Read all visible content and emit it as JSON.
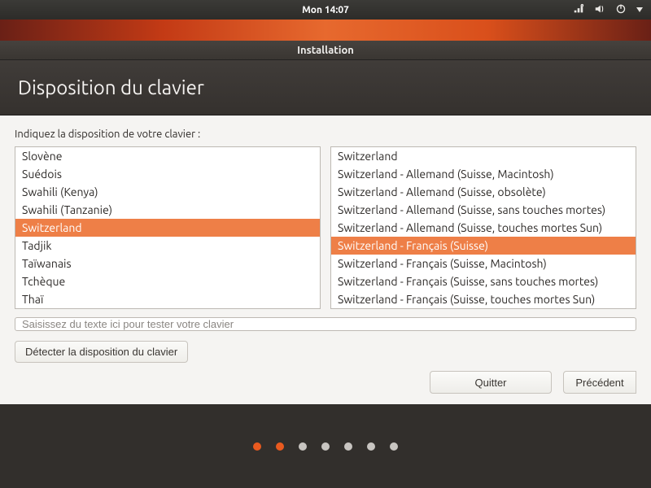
{
  "topbar": {
    "clock": "Mon 14:07"
  },
  "window": {
    "title": "Installation"
  },
  "heading": "Disposition du clavier",
  "prompt": "Indiquez la disposition de votre clavier :",
  "layouts": [
    {
      "label": "Slovène",
      "selected": false
    },
    {
      "label": "Suédois",
      "selected": false
    },
    {
      "label": "Swahili (Kenya)",
      "selected": false
    },
    {
      "label": "Swahili (Tanzanie)",
      "selected": false
    },
    {
      "label": "Switzerland",
      "selected": true
    },
    {
      "label": "Tadjik",
      "selected": false
    },
    {
      "label": "Taïwanais",
      "selected": false
    },
    {
      "label": "Tchèque",
      "selected": false
    },
    {
      "label": "Thaï",
      "selected": false
    }
  ],
  "variants": [
    {
      "label": "Switzerland",
      "selected": false
    },
    {
      "label": "Switzerland - Allemand (Suisse, Macintosh)",
      "selected": false
    },
    {
      "label": "Switzerland - Allemand (Suisse, obsolète)",
      "selected": false
    },
    {
      "label": "Switzerland - Allemand (Suisse, sans touches mortes)",
      "selected": false
    },
    {
      "label": "Switzerland - Allemand (Suisse, touches mortes Sun)",
      "selected": false
    },
    {
      "label": "Switzerland - Français (Suisse)",
      "selected": true
    },
    {
      "label": "Switzerland - Français (Suisse, Macintosh)",
      "selected": false
    },
    {
      "label": "Switzerland - Français (Suisse, sans touches mortes)",
      "selected": false
    },
    {
      "label": "Switzerland - Français (Suisse, touches mortes Sun)",
      "selected": false
    }
  ],
  "test_placeholder": "Saisissez du texte ici pour tester votre clavier",
  "detect_label": "Détecter la disposition du clavier",
  "actions": {
    "quit": "Quitter",
    "back": "Précédent"
  },
  "progress": {
    "total": 7,
    "active": [
      0,
      1
    ]
  }
}
